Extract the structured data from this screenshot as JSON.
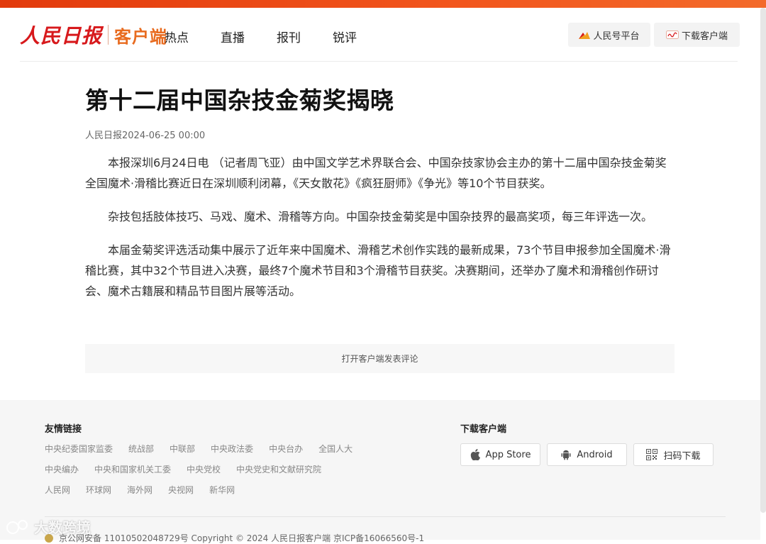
{
  "brand": {
    "logo_text": "人民日报",
    "app_label": "客户端",
    "accent": "#d7191c"
  },
  "nav": {
    "items": [
      {
        "label": "热点"
      },
      {
        "label": "直播"
      },
      {
        "label": "报刊"
      },
      {
        "label": "锐评"
      }
    ]
  },
  "header_buttons": {
    "platform": "人民号平台",
    "download": "下载客户端"
  },
  "article": {
    "title": "第十二届中国杂技金菊奖揭晓",
    "source_date": "人民日报2024-06-25 00:00",
    "paragraphs": [
      "本报深圳6月24日电 （记者周飞亚）由中国文学艺术界联合会、中国杂技家协会主办的第十二届中国杂技金菊奖全国魔术·滑稽比赛近日在深圳顺利闭幕，《天女散花》《疯狂厨师》《争光》等10个节目获奖。",
      "杂技包括肢体技巧、马戏、魔术、滑稽等方向。中国杂技金菊奖是中国杂技界的最高奖项，每三年评选一次。",
      "本届金菊奖评选活动集中展示了近年来中国魔术、滑稽艺术创作实践的最新成果，73个节目申报参加全国魔术·滑稽比赛，其中32个节目进入决赛，最终7个魔术节目和3个滑稽节目获奖。决赛期间，还举办了魔术和滑稽创作研讨会、魔术古籍展和精品节目图片展等活动。"
    ],
    "comment_prompt": "打开客户端发表评论"
  },
  "footer": {
    "links_title": "友情链接",
    "links": [
      [
        "中央纪委国家监委",
        "统战部",
        "中联部",
        "中央政法委",
        "中央台办",
        "全国人大"
      ],
      [
        "中央编办",
        "中央和国家机关工委",
        "中央党校",
        "中央党史和文献研究院"
      ],
      [
        "人民网",
        "环球网",
        "海外网",
        "央视网",
        "新华网"
      ]
    ],
    "download_title": "下载客户端",
    "download_buttons": {
      "appstore": "App Store",
      "android": "Android",
      "scan": "扫码下载"
    },
    "copyright": "京公网安备 11010502048729号 Copyright © 2024 人民日报客户端 京ICP备16066560号-1"
  },
  "watermark": "大数跨境"
}
